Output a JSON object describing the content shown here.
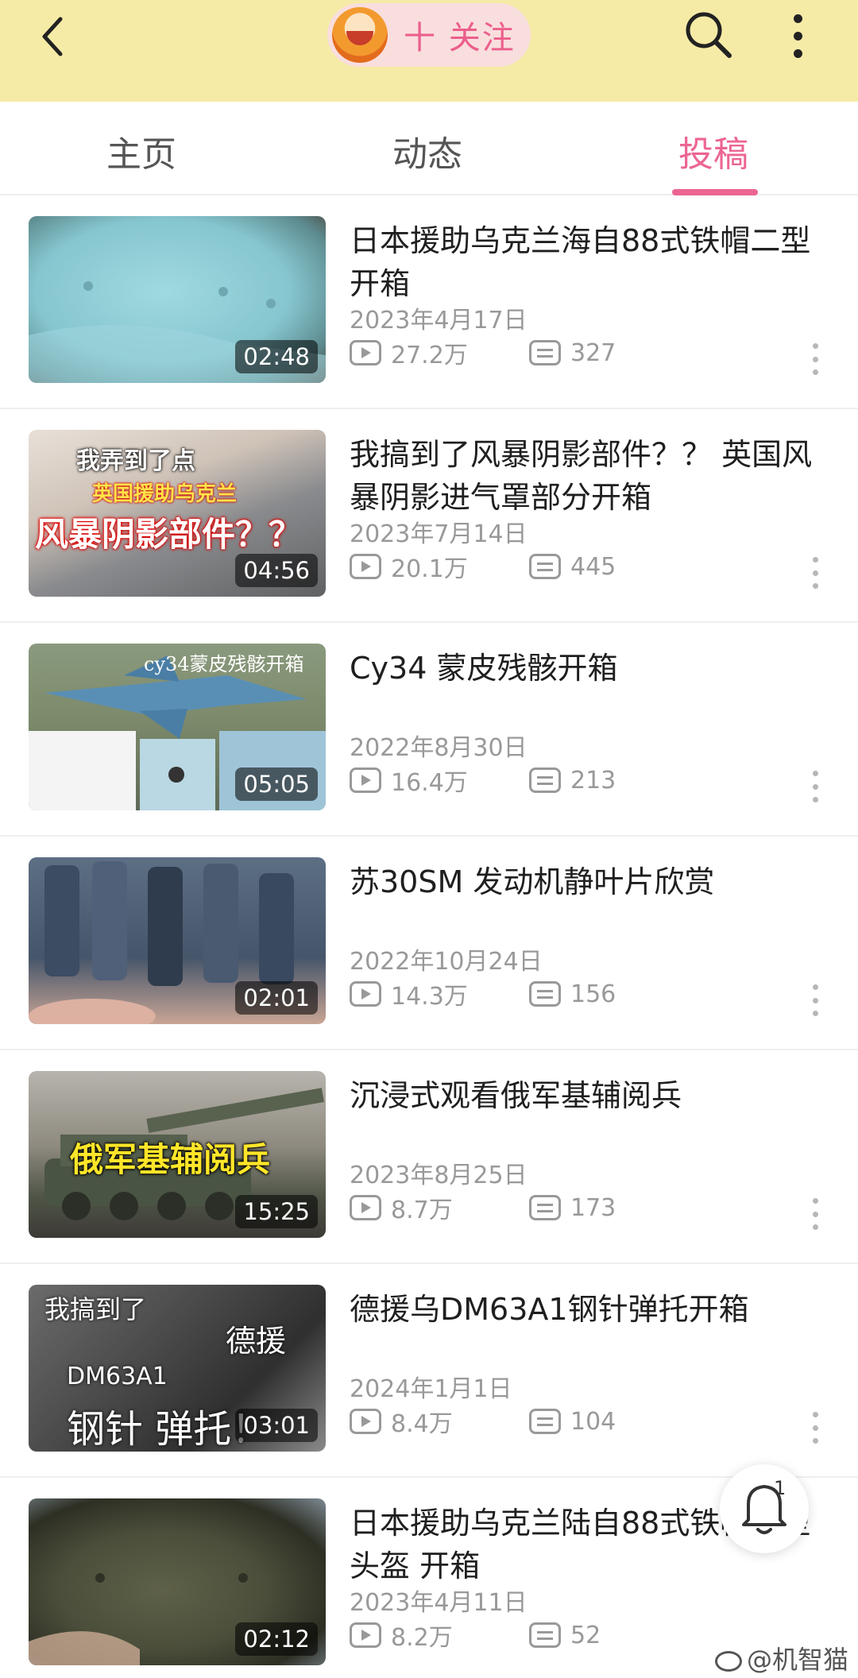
{
  "header": {
    "follow_label": "十 关注"
  },
  "tabs": [
    {
      "label": "主页"
    },
    {
      "label": "动态"
    },
    {
      "label": "投稿"
    }
  ],
  "videos": [
    {
      "title": "日本援助乌克兰海自88式铁帽二型 开箱",
      "date": "2023年4月17日",
      "views": "27.2万",
      "danmaku": "327",
      "duration": "02:48"
    },
    {
      "title": "我搞到了风暴阴影部件？？ 英国风暴阴影进气罩部分开箱",
      "date": "2023年7月14日",
      "views": "20.1万",
      "danmaku": "445",
      "duration": "04:56",
      "thumb_text": [
        "我弄到了点",
        "英国援助乌克兰",
        "风暴阴影部件？？"
      ]
    },
    {
      "title": "Cy34 蒙皮残骸开箱",
      "date": "2022年8月30日",
      "views": "16.4万",
      "danmaku": "213",
      "duration": "05:05",
      "thumb_text": [
        "cy34蒙皮残骸开箱"
      ]
    },
    {
      "title": "苏30SM 发动机静叶片欣赏",
      "date": "2022年10月24日",
      "views": "14.3万",
      "danmaku": "156",
      "duration": "02:01"
    },
    {
      "title": "沉浸式观看俄军基辅阅兵",
      "date": "2023年8月25日",
      "views": "8.7万",
      "danmaku": "173",
      "duration": "15:25",
      "thumb_text": [
        "俄军基辅阅兵"
      ]
    },
    {
      "title": "德援乌DM63A1钢针弹托开箱",
      "date": "2024年1月1日",
      "views": "8.4万",
      "danmaku": "104",
      "duration": "03:01",
      "thumb_text": [
        "我搞到了",
        "德援",
        "DM63A1",
        "钢针 弹托！"
      ]
    },
    {
      "title": "日本援助乌克兰陆自88式铁帽二型头盔 开箱",
      "date": "2023年4月11日",
      "views": "8.2万",
      "danmaku": "52",
      "duration": "02:12"
    }
  ],
  "fab": {
    "count": "1"
  },
  "watermark": "@机智猫",
  "colors": {
    "header_bg": "#f6eba6",
    "accent": "#ec6593",
    "follow_pill": "#f9dede"
  }
}
